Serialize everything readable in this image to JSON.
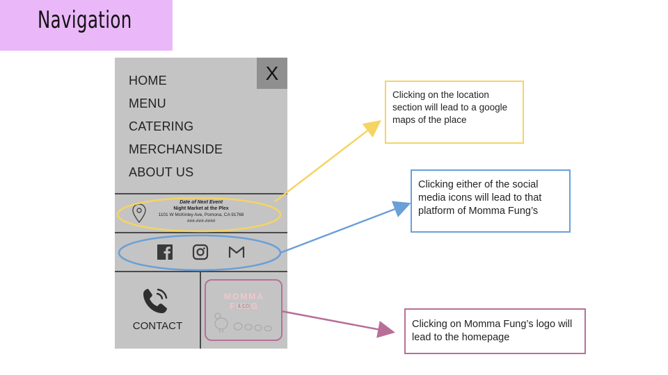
{
  "page": {
    "title": "Navigation"
  },
  "menu": {
    "close_label": "X",
    "items": [
      {
        "label": "HOME"
      },
      {
        "label": "MENU"
      },
      {
        "label": "CATERING"
      },
      {
        "label": "MERCHANSIDE"
      },
      {
        "label": "ABOUT US"
      }
    ]
  },
  "event": {
    "heading": "Date of Next Event",
    "venue": "Night Market at the Plex",
    "address": "1101 W McKinley Ave, Pomona, CA 91768",
    "phone": "###-###-####",
    "icon": "location-pin-icon"
  },
  "social": {
    "icons": [
      "facebook-icon",
      "instagram-icon",
      "gmail-icon"
    ]
  },
  "contact": {
    "label": "CONTACT",
    "icon": "phone-icon"
  },
  "logo": {
    "word": "MOMMA FUNG",
    "sub": "& CO."
  },
  "annotations": {
    "location": "Clicking on the location section will lead to a google maps of the place",
    "social": "Clicking either of the social media icons will lead to that platform of Momma Fung’s",
    "logo": "Clicking on Momma Fung’s logo will lead to the homepage"
  },
  "colors": {
    "title_bg": "#eab8f9",
    "yellow": "#f5d461",
    "blue": "#6a9fd8",
    "pink": "#b86e98",
    "menu_bg": "#c4c4c4"
  }
}
